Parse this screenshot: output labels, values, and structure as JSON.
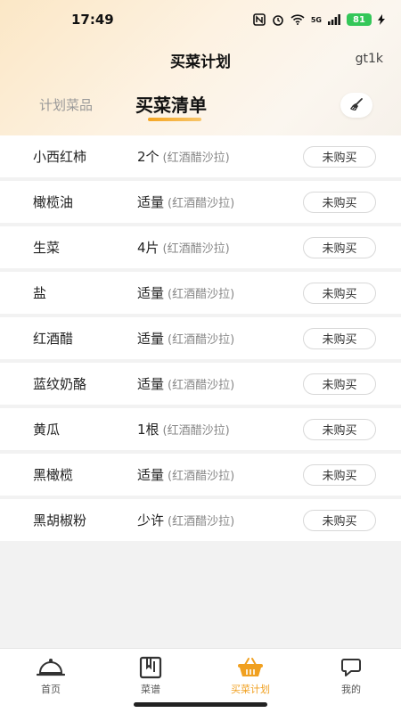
{
  "status_bar": {
    "time": "17:49",
    "network": "5G",
    "battery": "81"
  },
  "header": {
    "title": "买菜计划",
    "user_id": "gt1k"
  },
  "tabs": {
    "plan": "计划菜品",
    "list": "买菜清单"
  },
  "colors": {
    "accent": "#f0a020",
    "button_border": "#d8d8d8"
  },
  "items": [
    {
      "name": "小西红柿",
      "qty": "2个",
      "recipe": "(红酒醋沙拉)",
      "status": "未购买"
    },
    {
      "name": "橄榄油",
      "qty": "适量",
      "recipe": "(红酒醋沙拉)",
      "status": "未购买"
    },
    {
      "name": "生菜",
      "qty": "4片",
      "recipe": "(红酒醋沙拉)",
      "status": "未购买"
    },
    {
      "name": "盐",
      "qty": "适量",
      "recipe": "(红酒醋沙拉)",
      "status": "未购买"
    },
    {
      "name": "红酒醋",
      "qty": "适量",
      "recipe": "(红酒醋沙拉)",
      "status": "未购买"
    },
    {
      "name": "蓝纹奶酪",
      "qty": "适量",
      "recipe": "(红酒醋沙拉)",
      "status": "未购买"
    },
    {
      "name": "黄瓜",
      "qty": "1根",
      "recipe": "(红酒醋沙拉)",
      "status": "未购买"
    },
    {
      "name": "黑橄榄",
      "qty": "适量",
      "recipe": "(红酒醋沙拉)",
      "status": "未购买"
    },
    {
      "name": "黑胡椒粉",
      "qty": "少许",
      "recipe": "(红酒醋沙拉)",
      "status": "未购买"
    }
  ],
  "tabbar": {
    "home": "首页",
    "recipes": "菜谱",
    "plan": "买菜计划",
    "mine": "我的"
  }
}
